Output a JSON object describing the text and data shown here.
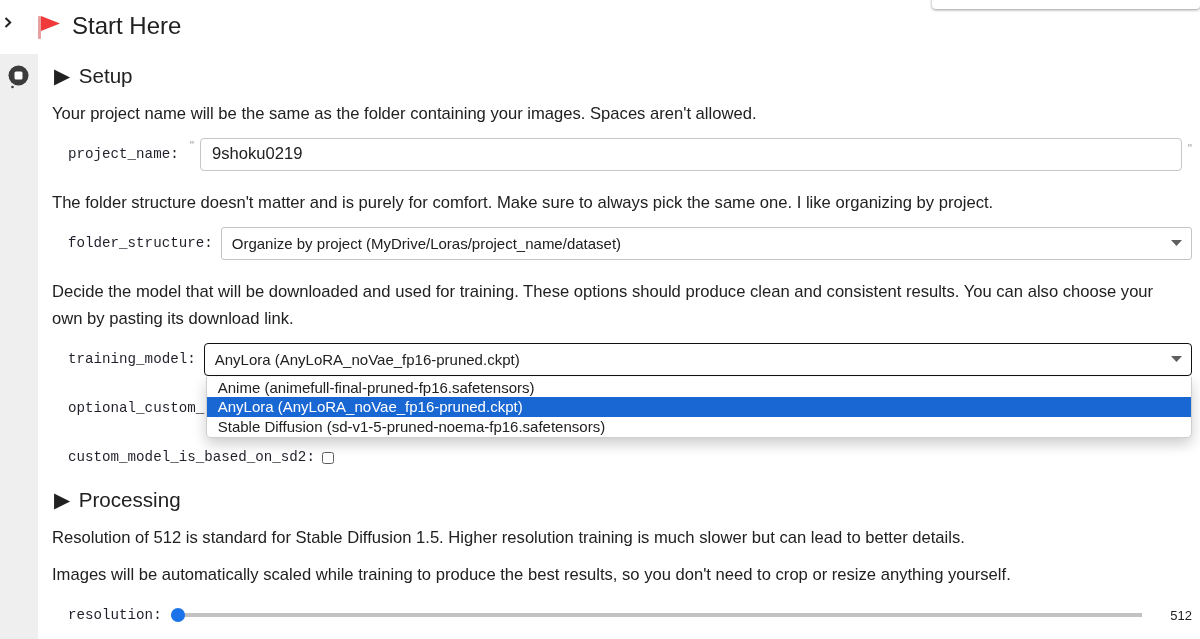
{
  "header": {
    "title": "Start Here"
  },
  "cell": {
    "running": true,
    "form": [
      {
        "kind": "heading",
        "text": "▶ Setup"
      },
      {
        "kind": "paragraph",
        "text": "Your project name will be the same as the folder containing your images. Spaces aren't allowed."
      },
      {
        "kind": "text_field",
        "label": "project_name:",
        "value": "9shoku0219",
        "open_quote": "\"",
        "close_quote": "\""
      },
      {
        "kind": "paragraph",
        "text": "The folder structure doesn't matter and is purely for comfort. Make sure to always pick the same one. I like organizing by project."
      },
      {
        "kind": "dropdown",
        "label": "folder_structure:",
        "value": "Organize by project (MyDrive/Loras/project_name/dataset)",
        "expanded": false
      },
      {
        "kind": "paragraph",
        "text": "Decide the model that will be downloaded and used for training. These options should produce clean and consistent results. You can also choose your own by pasting its download link."
      },
      {
        "kind": "dropdown",
        "label": "training_model:",
        "value": "AnyLora (AnyLoRA_noVae_fp16-pruned.ckpt)",
        "expanded": true,
        "options": [
          {
            "label": "Anime (animefull-final-pruned-fp16.safetensors)",
            "selected": false
          },
          {
            "label": "AnyLora (AnyLoRA_noVae_fp16-pruned.ckpt)",
            "selected": true
          },
          {
            "label": "Stable Diffusion (sd-v1-5-pruned-noema-fp16.safetensors)",
            "selected": false
          }
        ]
      },
      {
        "kind": "covered_field",
        "label": "optional_custom_"
      },
      {
        "kind": "checkbox",
        "label": "custom_model_is_based_on_sd2:",
        "checked": false
      },
      {
        "kind": "heading",
        "text": "▶ Processing"
      },
      {
        "kind": "paragraph",
        "text": "Resolution of 512 is standard for Stable Diffusion 1.5. Higher resolution training is much slower but can lead to better details."
      },
      {
        "kind": "paragraph",
        "text": "Images will be automatically scaled while training to produce the best results, so you don't need to crop or resize anything yourself."
      },
      {
        "kind": "slider",
        "label": "resolution:",
        "level": 0,
        "reading": "512"
      }
    ]
  }
}
